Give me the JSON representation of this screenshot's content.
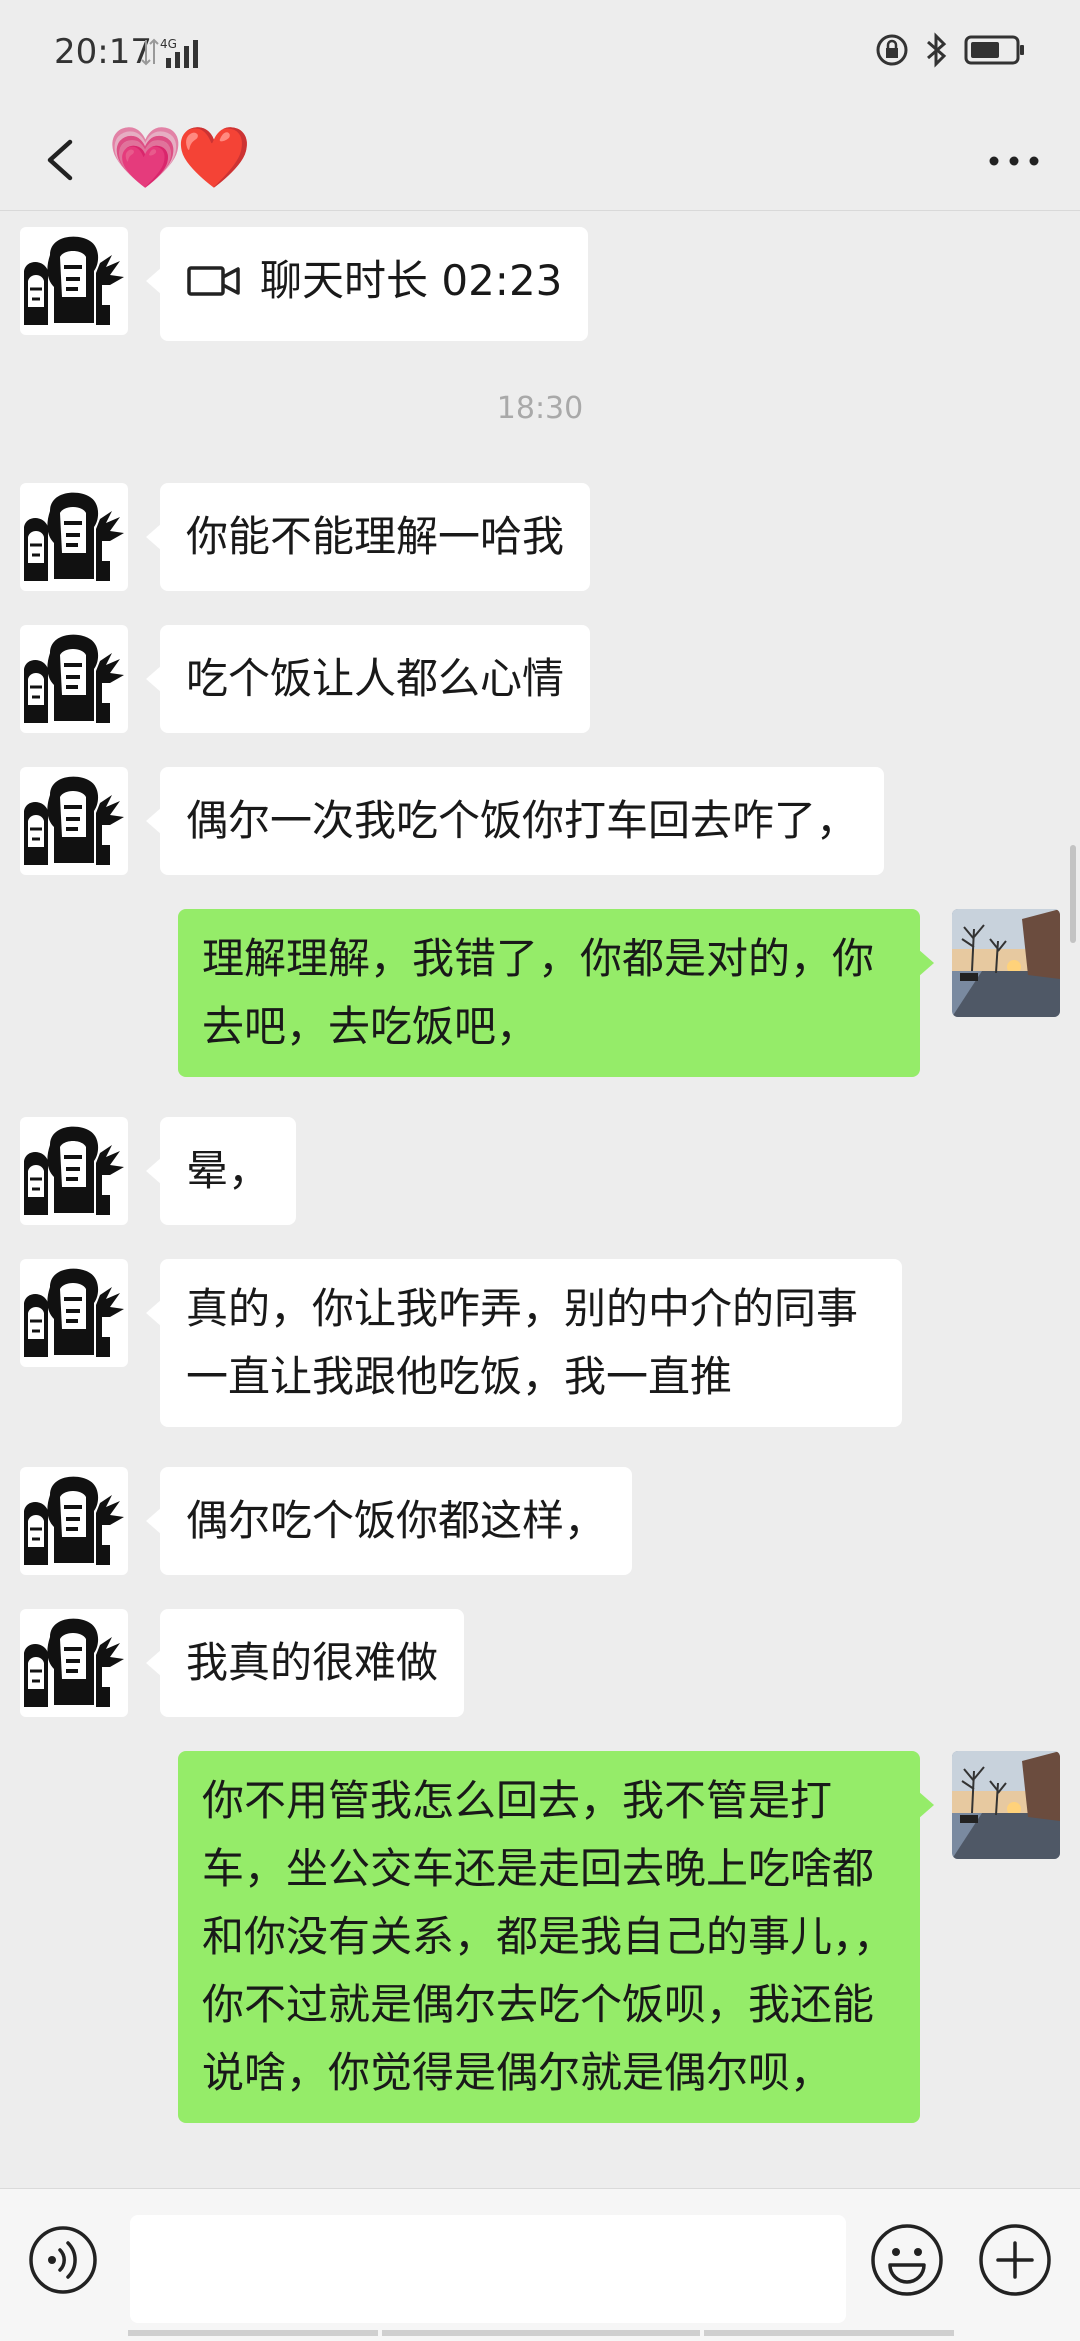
{
  "status_bar": {
    "time": "20:17",
    "network": "4G"
  },
  "header": {
    "title": "💗❤️"
  },
  "chat": {
    "call": {
      "text": "聊天时长 02:23"
    },
    "timestamp": "18:30",
    "messages": [
      {
        "side": "in",
        "text": "你能不能理解一哈我"
      },
      {
        "side": "in",
        "text": "吃个饭让人都么心情"
      },
      {
        "side": "in",
        "text": "偶尔一次我吃个饭你打车回去咋了，"
      },
      {
        "side": "out",
        "text": "理解理解，我错了，你都是对的，你去吧，去吃饭吧，"
      },
      {
        "side": "in",
        "text": "晕，"
      },
      {
        "side": "in",
        "text": "真的，你让我咋弄，别的中介的同事一直让我跟他吃饭，我一直推"
      },
      {
        "side": "in",
        "text": "偶尔吃个饭你都这样，"
      },
      {
        "side": "in",
        "text": "我真的很难做"
      },
      {
        "side": "out",
        "text": "你不用管我怎么回去，我不管是打车，坐公交车还是走回去晚上吃啥都和你没有关系，都是我自己的事儿，，你不过就是偶尔去吃个饭呗，我还能说啥，你觉得是偶尔就是偶尔呗，"
      }
    ]
  },
  "input_bar": {
    "placeholder": ""
  }
}
